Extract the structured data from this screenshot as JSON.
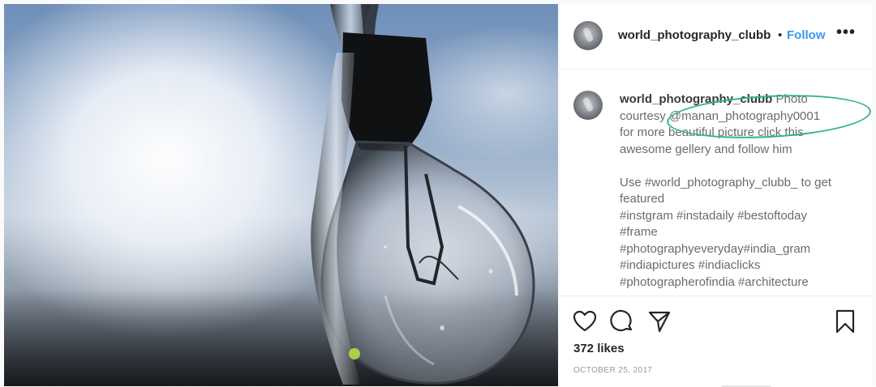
{
  "post": {
    "username": "world_photography_clubb",
    "separator": "•",
    "follow_label": "Follow",
    "more_label": "•••"
  },
  "caption": {
    "username": "world_photography_clubb",
    "line1_rest": " Photo",
    "line2": "courtesy @manan_photography0001",
    "line3": "for more beautiful picture click this",
    "line4": "awesome gellery and follow him",
    "line5": "Use #world_photography_clubb_ to get",
    "line6": "featured",
    "line7": "#instgram #instadaily #bestoftoday",
    "line8": "#frame",
    "line9": "#photographyeveryday#india_gram",
    "line10": "#indiapictures #indiaclicks",
    "line11": "#photographerofindia #architecture"
  },
  "actions": {
    "icons": [
      "heart-icon",
      "comment-icon",
      "share-icon",
      "bookmark-icon"
    ],
    "likes": "372 likes",
    "date": "OCTOBER 25, 2017"
  },
  "colors": {
    "accent": "#3897f0",
    "highlight": "#2db58c",
    "text": "#262626"
  }
}
